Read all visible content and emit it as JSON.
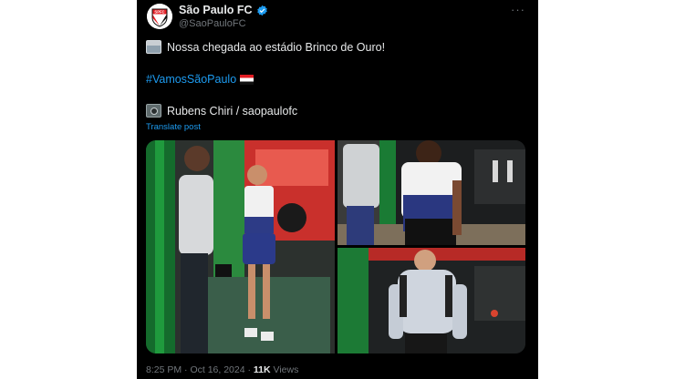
{
  "account": {
    "display_name": "São Paulo FC",
    "handle": "@SaoPauloFC",
    "logo_text": "SPFC",
    "verified_icon": "verified-badge-icon",
    "more_label": "···"
  },
  "post": {
    "line1": "Nossa chegada ao estádio Brinco de Ouro!",
    "hashtag": "#VamosSãoPaulo",
    "line3": "Rubens Chiri / saopaulofc",
    "translate": "Translate post",
    "media": [
      {
        "description_icon": "photo-player-walking-icon"
      },
      {
        "description_icon": "photo-player-arriving-icon"
      },
      {
        "description_icon": "photo-player-hoodie-icon"
      }
    ]
  },
  "meta": {
    "time": "8:25 PM",
    "sep1": "·",
    "date": "Oct 16, 2024",
    "sep2": "·",
    "views_count": "11K",
    "views_label": "Views"
  },
  "colors": {
    "background": "#000000",
    "text": "#e7e9ea",
    "secondary": "#71767b",
    "link": "#1d9bf0",
    "spfc_red": "#e31c23"
  }
}
